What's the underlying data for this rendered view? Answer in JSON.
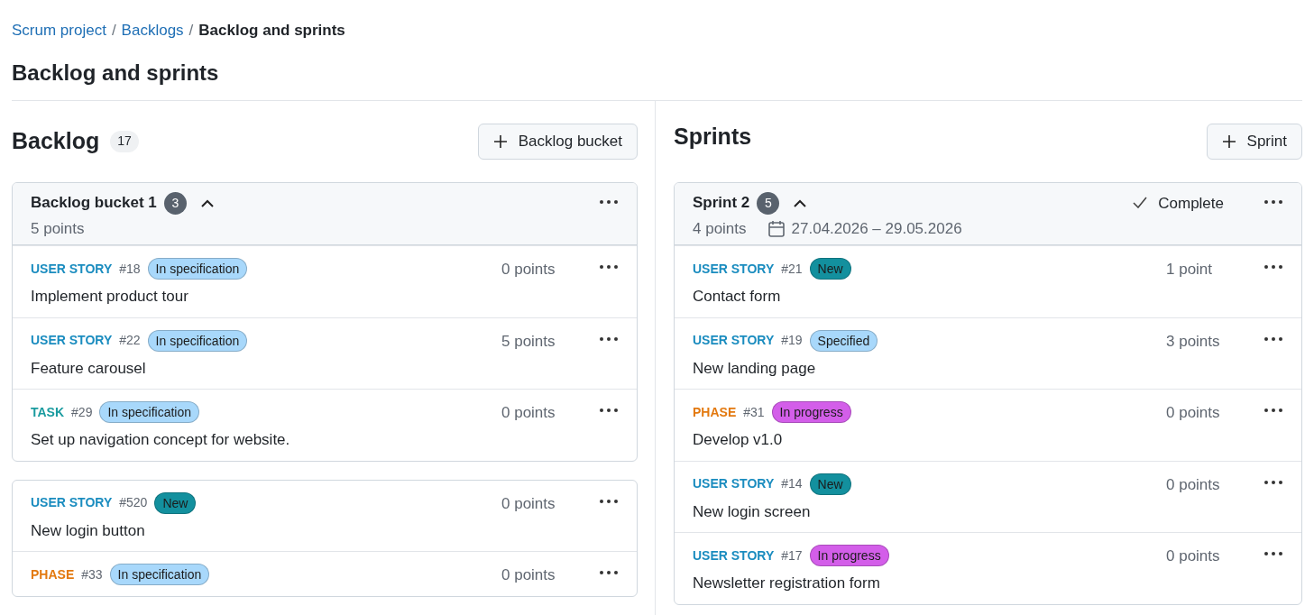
{
  "breadcrumb": {
    "separator": "/",
    "items": [
      {
        "label": "Scrum project",
        "kind": "link"
      },
      {
        "label": "Backlogs",
        "kind": "link"
      },
      {
        "label": "Backlog and sprints",
        "kind": "current"
      }
    ]
  },
  "page_title": "Backlog and sprints",
  "backlog": {
    "title": "Backlog",
    "count": "17",
    "add_button": "Backlog bucket",
    "buckets": [
      {
        "title": "Backlog bucket 1",
        "count": "3",
        "points": "5 points",
        "expanded": true,
        "items": [
          {
            "kind": "user_story",
            "type": "USER STORY",
            "id": "#18",
            "status": "In specification",
            "color": "#a8d8fb",
            "points": "0 points",
            "title": "Implement product tour"
          },
          {
            "kind": "user_story",
            "type": "USER STORY",
            "id": "#22",
            "status": "In specification",
            "color": "#a8d8fb",
            "points": "5 points",
            "title": "Feature carousel"
          },
          {
            "kind": "task",
            "type": "TASK",
            "id": "#29",
            "status": "In specification",
            "color": "#a8d8fb",
            "points": "0 points",
            "title": "Set up navigation concept for website."
          }
        ]
      }
    ],
    "items": [
      {
        "kind": "user_story",
        "type": "USER STORY",
        "id": "#520",
        "status": "New",
        "color": "#13909e",
        "points": "0 points",
        "title": "New login button"
      },
      {
        "kind": "phase",
        "type": "PHASE",
        "id": "#33",
        "status": "In specification",
        "color": "#a8d8fb",
        "points": "0 points"
      }
    ]
  },
  "sprints": {
    "title": "Sprints",
    "add_button": "Sprint",
    "sprint": {
      "title": "Sprint 2",
      "count": "5",
      "points": "4 points",
      "dates": "27.04.2026 – 29.05.2026",
      "complete": "Complete",
      "expanded": true,
      "items": [
        {
          "kind": "user_story",
          "type": "USER STORY",
          "id": "#21",
          "status": "New",
          "color": "#13909e",
          "points": "1 point",
          "title": "Contact form"
        },
        {
          "kind": "user_story",
          "type": "USER STORY",
          "id": "#19",
          "status": "Specified",
          "color": "#a8d8fb",
          "points": "3 points",
          "title": "New landing page"
        },
        {
          "kind": "phase",
          "type": "PHASE",
          "id": "#31",
          "status": "In progress",
          "color": "#d35ee9",
          "points": "0 points",
          "title": "Develop v1.0"
        },
        {
          "kind": "user_story",
          "type": "USER STORY",
          "id": "#14",
          "status": "New",
          "color": "#13909e",
          "points": "0 points",
          "title": "New login screen"
        },
        {
          "kind": "user_story",
          "type": "USER STORY",
          "id": "#17",
          "status": "In progress",
          "color": "#d35ee9",
          "points": "0 points",
          "title": "Newsletter registration form"
        }
      ]
    }
  }
}
